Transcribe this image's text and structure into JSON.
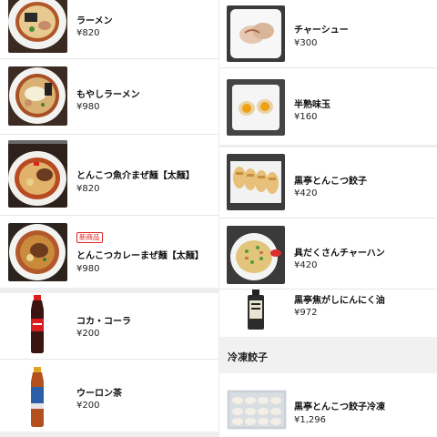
{
  "left_column": [
    {
      "name": "ラーメン",
      "price": "¥820",
      "icon": "ramen-bowl-icon"
    },
    {
      "name": "もやしラーメン",
      "price": "¥980",
      "icon": "moyashi-ramen-icon"
    },
    {
      "name": "とんこつ魚介まぜ麺【太麺】",
      "price": "¥820",
      "icon": "mazemen-icon"
    },
    {
      "name": "とんこつカレーまぜ麺【太麺】",
      "price": "¥980",
      "badge": "新商品",
      "icon": "curry-mazemen-icon"
    },
    {
      "name": "コカ・コーラ",
      "price": "¥200",
      "icon": "cola-bottle-icon"
    },
    {
      "name": "ウーロン茶",
      "price": "¥200",
      "icon": "oolong-tea-bottle-icon"
    }
  ],
  "right_column": [
    {
      "name": "チャーシュー",
      "price": "¥300",
      "icon": "chashu-icon"
    },
    {
      "name": "半熟味玉",
      "price": "¥160",
      "icon": "egg-icon"
    },
    {
      "name": "黒亭とんこつ餃子",
      "price": "¥420",
      "icon": "gyoza-icon"
    },
    {
      "name": "具だくさんチャーハン",
      "price": "¥420",
      "icon": "fried-rice-icon"
    },
    {
      "name": "黒亭焦がしにんにく油",
      "price": "¥972",
      "icon": "garlic-oil-bottle-icon"
    }
  ],
  "section": {
    "title": "冷凍餃子"
  },
  "frozen": [
    {
      "name": "黒亭とんこつ餃子冷凍",
      "price": "¥1,296",
      "icon": "frozen-gyoza-pack-icon"
    }
  ]
}
